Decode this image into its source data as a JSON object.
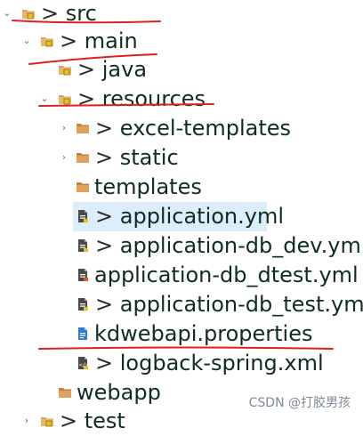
{
  "tree": {
    "items": [
      {
        "name": "src",
        "prefix": "> ",
        "kind": "package-folder",
        "twisty": "expanded"
      },
      {
        "name": "main",
        "prefix": "> ",
        "kind": "package-folder",
        "twisty": "expanded"
      },
      {
        "name": "java",
        "prefix": "> ",
        "kind": "package-folder",
        "twisty": "none"
      },
      {
        "name": "resources",
        "prefix": "> ",
        "kind": "package-folder",
        "twisty": "expanded"
      },
      {
        "name": "excel-templates",
        "prefix": "> ",
        "kind": "folder",
        "twisty": "collapsed"
      },
      {
        "name": "static",
        "prefix": "> ",
        "kind": "folder",
        "twisty": "collapsed"
      },
      {
        "name": "templates",
        "prefix": "",
        "kind": "folder",
        "twisty": "none"
      },
      {
        "name": "application.yml",
        "prefix": "> ",
        "kind": "yml-file",
        "twisty": "none",
        "selected": true
      },
      {
        "name": "application-db_dev.yml",
        "prefix": "> ",
        "kind": "yml-file",
        "twisty": "none"
      },
      {
        "name": "application-db_dtest.yml",
        "prefix": "",
        "kind": "yml-file",
        "twisty": "none"
      },
      {
        "name": "application-db_test.yml",
        "prefix": "> ",
        "kind": "yml-file",
        "twisty": "none"
      },
      {
        "name": "kdwebapi.properties",
        "prefix": "",
        "kind": "properties-file",
        "twisty": "none"
      },
      {
        "name": "logback-spring.xml",
        "prefix": "> ",
        "kind": "xml-file",
        "twisty": "none"
      },
      {
        "name": "webapp",
        "prefix": "",
        "kind": "folder",
        "twisty": "none"
      },
      {
        "name": "test",
        "prefix": "> ",
        "kind": "package-folder",
        "twisty": "collapsed"
      }
    ]
  },
  "watermark": {
    "text": "CSDN @打胶男孩"
  },
  "colors": {
    "folder": "#e0a25a",
    "folder_dark": "#c0843c",
    "package_badge": "#e8c21c",
    "selection": "#dceefc",
    "annotation_red": "#e02020",
    "file_blue": "#2e7bd6"
  },
  "icons": {
    "expanded_twisty": "chevron-down-icon",
    "collapsed_twisty": "chevron-right-icon",
    "package_folder": "package-folder-icon",
    "folder": "folder-icon",
    "yml_file": "yml-file-icon",
    "properties_file": "properties-file-icon",
    "xml_file": "xml-file-icon"
  }
}
